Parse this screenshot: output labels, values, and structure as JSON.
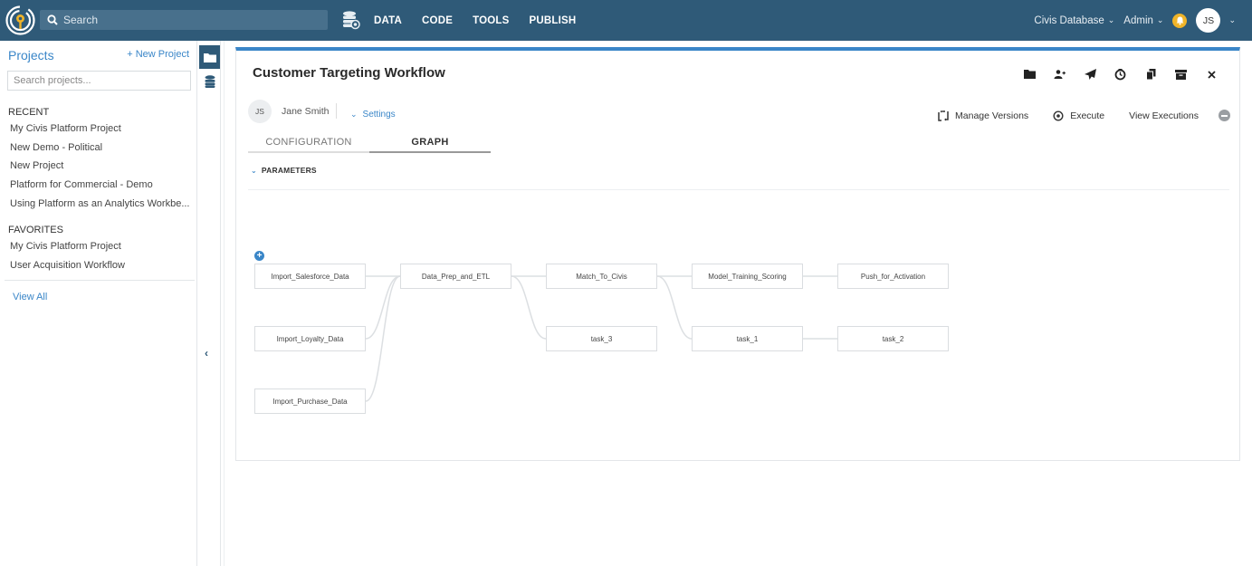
{
  "topbar": {
    "search_placeholder": "Search",
    "nav": [
      "DATA",
      "CODE",
      "TOOLS",
      "PUBLISH"
    ],
    "database_label": "Civis Database",
    "admin_label": "Admin",
    "user_initials": "JS"
  },
  "sidebar": {
    "title": "Projects",
    "new_project": "+ New Project",
    "search_placeholder": "Search projects...",
    "recent_header": "RECENT",
    "recent": [
      "My Civis Platform Project",
      "New Demo - Political",
      "New Project",
      "Platform for Commercial - Demo",
      "Using Platform as an Analytics Workbe..."
    ],
    "favorites_header": "FAVORITES",
    "favorites": [
      "My Civis Platform Project",
      "User Acquisition Workflow"
    ],
    "view_all": "View All"
  },
  "panel": {
    "title": "Customer Targeting Workflow",
    "toolbar_icons": [
      "folder-icon",
      "share-user-icon",
      "send-icon",
      "schedule-clock-icon",
      "clone-icon",
      "archive-icon",
      "close-icon"
    ],
    "owner_initials": "JS",
    "owner_name": "Jane Smith",
    "settings_label": "Settings",
    "actions": {
      "manage_versions": "Manage Versions",
      "execute": "Execute",
      "view_executions": "View Executions"
    },
    "tabs": [
      {
        "label": "CONFIGURATION",
        "active": false
      },
      {
        "label": "GRAPH",
        "active": true
      }
    ],
    "parameters_label": "PARAMETERS"
  },
  "graph": {
    "nodes": [
      {
        "id": "n1",
        "label": "Import_Salesforce_Data"
      },
      {
        "id": "n2",
        "label": "Import_Loyalty_Data"
      },
      {
        "id": "n3",
        "label": "Import_Purchase_Data"
      },
      {
        "id": "n4",
        "label": "Data_Prep_and_ETL"
      },
      {
        "id": "n5",
        "label": "Match_To_Civis"
      },
      {
        "id": "n6",
        "label": "task_3"
      },
      {
        "id": "n7",
        "label": "Model_Training_Scoring"
      },
      {
        "id": "n8",
        "label": "task_1"
      },
      {
        "id": "n9",
        "label": "Push_for_Activation"
      },
      {
        "id": "n10",
        "label": "task_2"
      }
    ],
    "edges": [
      [
        "n1",
        "n4"
      ],
      [
        "n2",
        "n4"
      ],
      [
        "n3",
        "n4"
      ],
      [
        "n4",
        "n5"
      ],
      [
        "n4",
        "n6"
      ],
      [
        "n5",
        "n7"
      ],
      [
        "n5",
        "n8"
      ],
      [
        "n7",
        "n9"
      ],
      [
        "n8",
        "n10"
      ]
    ]
  }
}
